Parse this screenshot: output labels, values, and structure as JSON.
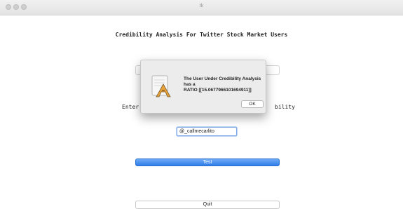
{
  "window": {
    "title": "tk"
  },
  "app": {
    "heading": "Credibility Analysis For Twitter Stock Market Users",
    "label_left": "Enter",
    "label_right": "bility",
    "username_value": "@_callmecarlito",
    "test_label": "Test",
    "quit_label": "Quit"
  },
  "dialog": {
    "message_line1": "The User Under Credibility Analysis has a",
    "message_line2": "RATIO [[15.0677966101694911]]",
    "ok_label": "OK",
    "icon": "app-icon-pencil-ruler"
  }
}
